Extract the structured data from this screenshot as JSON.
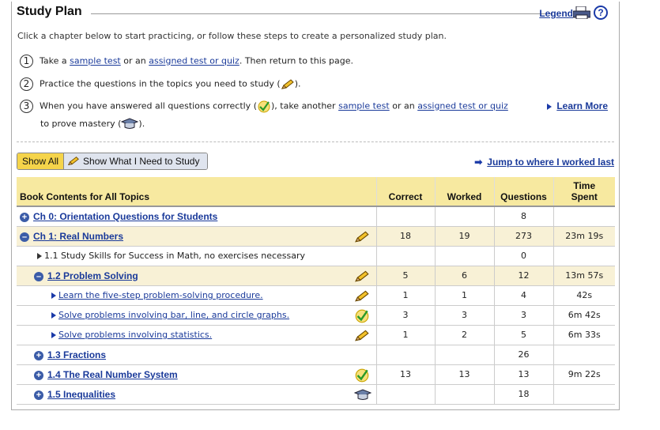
{
  "header": {
    "title": "Study Plan",
    "legend_label": "Legend",
    "print_icon": "printer-icon",
    "help_icon": "help-icon",
    "help_glyph": "?"
  },
  "intro": "Click a chapter below to start practicing, or follow these steps to create a personalized study plan.",
  "steps": {
    "s1": {
      "num": "1",
      "pre": "Take a ",
      "link1": "sample test",
      "mid": " or an ",
      "link2": "assigned test or quiz",
      "post": ". Then return to this page."
    },
    "s2": {
      "num": "2",
      "pre": "Practice the questions in the topics you need to study (",
      "post": ")."
    },
    "s3": {
      "num": "3",
      "pre": "When you have answered all questions correctly (",
      "mid1": "), take another ",
      "link1": "sample test",
      "mid2": " or an ",
      "link2": "assigned test or quiz",
      "line2_pre": "to prove mastery (",
      "line2_post": ")."
    }
  },
  "learn_more": "Learn More",
  "toggle": {
    "show_all": "Show All",
    "show_need": "Show What I Need to Study"
  },
  "jump_label": "Jump to where I worked last",
  "table": {
    "headers": {
      "book": "Book Contents for All Topics",
      "correct": "Correct",
      "worked": "Worked",
      "questions": "Questions",
      "time_line1": "Time",
      "time_line2": "Spent"
    },
    "rows": [
      {
        "name": "Ch 0: Orientation Questions for Students",
        "correct": "",
        "worked": "",
        "questions": "8",
        "time": ""
      },
      {
        "name": "Ch 1: Real Numbers",
        "correct": "18",
        "worked": "19",
        "questions": "273",
        "time": "23m 19s"
      },
      {
        "name": "1.1 Study Skills for Success in Math, no exercises necessary",
        "correct": "",
        "worked": "",
        "questions": "0",
        "time": ""
      },
      {
        "name": "1.2 Problem Solving",
        "correct": "5",
        "worked": "6",
        "questions": "12",
        "time": "13m 57s"
      },
      {
        "name": "Learn the five-step problem-solving procedure.",
        "correct": "1",
        "worked": "1",
        "questions": "4",
        "time": "42s"
      },
      {
        "name": "Solve problems involving bar, line, and circle graphs.",
        "correct": "3",
        "worked": "3",
        "questions": "3",
        "time": "6m 42s"
      },
      {
        "name": "Solve problems involving statistics.",
        "correct": "1",
        "worked": "2",
        "questions": "5",
        "time": "6m 33s"
      },
      {
        "name": "1.3 Fractions",
        "correct": "",
        "worked": "",
        "questions": "26",
        "time": ""
      },
      {
        "name": "1.4 The Real Number System",
        "correct": "13",
        "worked": "13",
        "questions": "13",
        "time": "9m 22s"
      },
      {
        "name": "1.5 Inequalities",
        "correct": "",
        "worked": "",
        "questions": "18",
        "time": ""
      }
    ]
  },
  "icons": {
    "pencil": "pencil-icon",
    "check": "mastered-check-icon",
    "grad": "graduation-cap-icon",
    "expand": "+",
    "collapse": "–"
  }
}
